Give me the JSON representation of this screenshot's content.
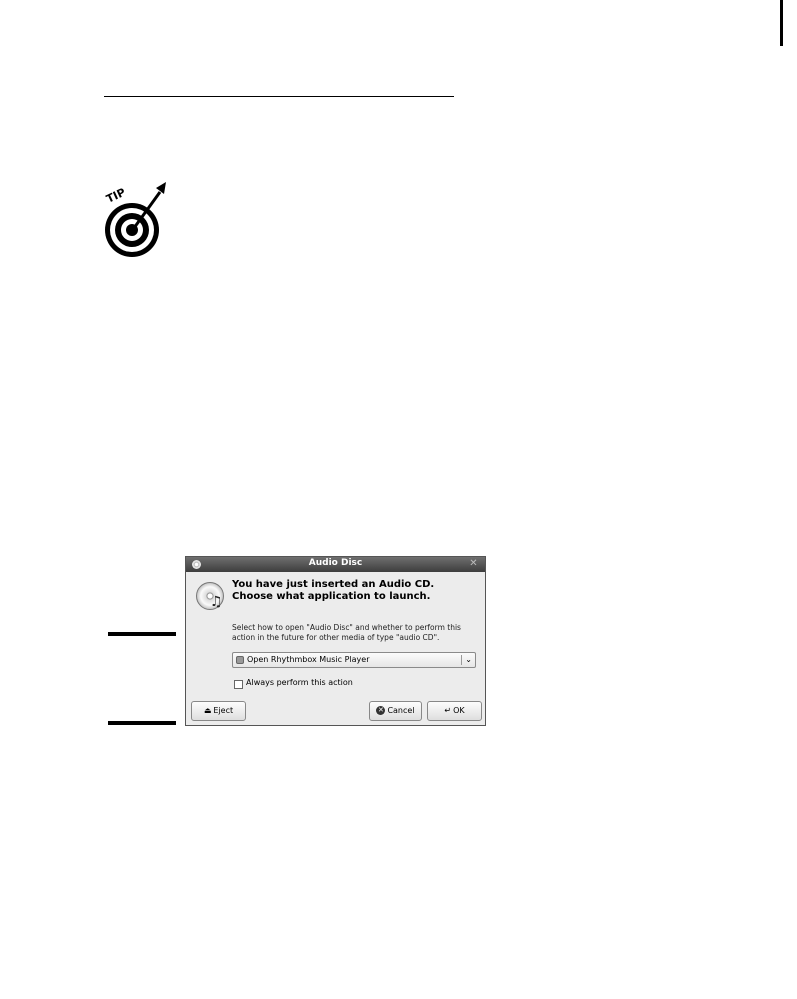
{
  "dialog": {
    "title": "Audio Disc",
    "heading": "You have just inserted an Audio CD. Choose what application to launch.",
    "description": "Select how to open \"Audio Disc\" and whether to perform this action in the future for other media of type \"audio CD\".",
    "selected_action": "Open Rhythmbox Music Player",
    "always_perform_label": "Always perform this action",
    "always_perform_checked": false,
    "buttons": {
      "eject": "Eject",
      "cancel": "Cancel",
      "ok": "OK"
    }
  },
  "tip_icon_label": "TIP",
  "icons": {
    "tip": "tip-target-icon",
    "window": "window-menu-icon",
    "close": "close-icon",
    "cd": "cd-icon",
    "app": "rhythmbox-icon",
    "dropdown": "chevron-down-icon",
    "eject": "eject-icon",
    "cancel": "cancel-icon",
    "ok": "ok-icon"
  }
}
